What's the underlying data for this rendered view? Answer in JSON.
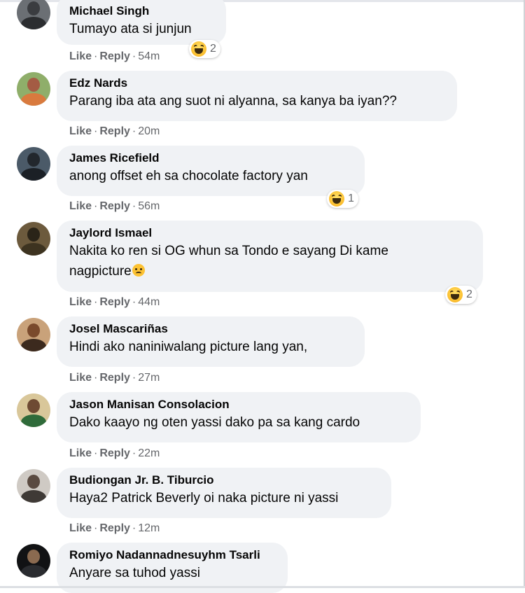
{
  "actions": {
    "like": "Like",
    "reply": "Reply",
    "dot": "·"
  },
  "comments": [
    {
      "name": "Michael Singh",
      "lines": [
        "Tumayo ata si junjun"
      ],
      "time": "54m",
      "reaction": {
        "type": "haha",
        "count": "2"
      }
    },
    {
      "name": "Edz Nards",
      "lines": [
        "Parang iba ata ang suot ni alyanna, sa kanya ba iyan??"
      ],
      "time": "20m",
      "reaction": null
    },
    {
      "name": "James Ricefield",
      "lines": [
        "anong offset eh sa chocolate factory yan"
      ],
      "time": "56m",
      "reaction": {
        "type": "haha",
        "count": "1"
      }
    },
    {
      "name": "Jaylord Ismael",
      "lines": [
        "Nakita ko ren si OG whun sa Tondo e sayang Di kame",
        "nagpicture"
      ],
      "time": "44m",
      "reaction": {
        "type": "haha",
        "count": "2"
      }
    },
    {
      "name": "Josel Mascariñas",
      "lines": [
        "Hindi ako naniniwalang picture lang yan,"
      ],
      "time": "27m",
      "reaction": null
    },
    {
      "name": "Jason Manisan Consolacion",
      "lines": [
        "Dako kaayo ng oten yassi dako pa sa kang cardo"
      ],
      "time": "22m",
      "reaction": null
    },
    {
      "name": "Budiongan Jr. B. Tiburcio",
      "lines": [
        "Haya2 Patrick Beverly oi naka picture ni yassi"
      ],
      "time": "12m",
      "reaction": null
    },
    {
      "name": "Romiyo Nadannadnesuyhm Tsarli",
      "lines": [
        "Anyare sa tuhod yassi"
      ],
      "time": "",
      "reaction": null
    }
  ],
  "colors": {
    "bubble": "#f0f2f5",
    "meta": "#65676b",
    "text": "#050505"
  }
}
